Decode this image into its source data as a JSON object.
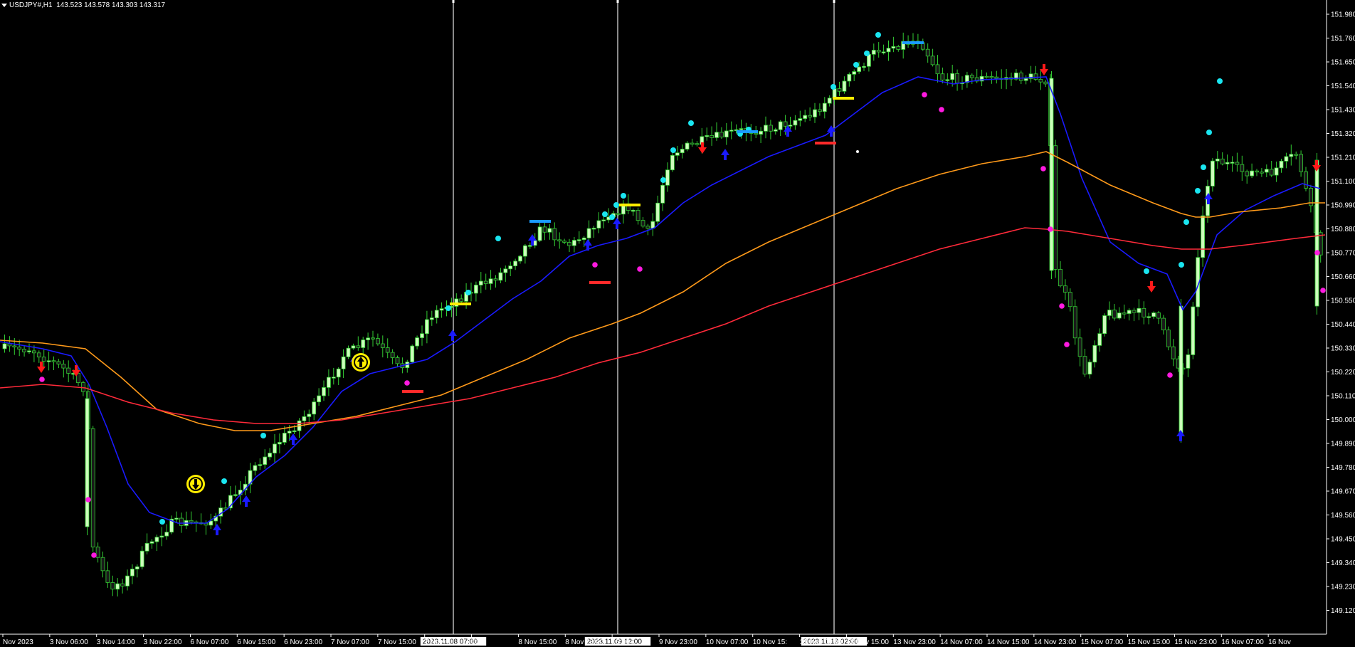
{
  "app": {
    "symbol_label": "USDJPY#,H1",
    "ohlc_text": "143.523 143.578 143.303 143.317"
  },
  "price_axis": {
    "labels": [
      "151.980",
      "151.760",
      "151.650",
      "151.540",
      "151.430",
      "151.320",
      "151.210",
      "151.100",
      "150.990",
      "150.880",
      "150.770",
      "150.660",
      "150.550",
      "150.440",
      "150.330",
      "150.220",
      "150.110",
      "150.000",
      "149.890",
      "149.780",
      "149.670",
      "149.560",
      "149.450",
      "149.340",
      "149.230",
      "149.120"
    ]
  },
  "time_axis": {
    "labels": [
      "Nov 2023",
      "3 Nov 06:00",
      "3 Nov 14:00",
      "3 Nov 22:00",
      "6 Nov 07:00",
      "6 Nov 15:00",
      "6 Nov 23:00",
      "7 Nov 07:00",
      "7 Nov 15:00",
      "7 Nov",
      "00",
      "8 Nov 15:00",
      "8 Nov 23:00",
      "15:00",
      "9 Nov 23:00",
      "10 Nov 07:00",
      "10 Nov 15:",
      "13 Nov 07:00",
      "13 Nov 15:00",
      "13 Nov 23:00",
      "14 Nov 07:00",
      "14 Nov 15:00",
      "14 Nov 23:00",
      "15 Nov 07:00",
      "15 Nov 15:00",
      "15 Nov 23:00",
      "16 Nov 07:00",
      "16 Nov"
    ]
  },
  "vertical_lines": [
    {
      "tag": "2023.11.08 07:00"
    },
    {
      "tag": "2023.11.09 12:00"
    },
    {
      "tag": "2023.11.13 02:00"
    }
  ],
  "colors": {
    "background": "#000000",
    "candle_up": "#ccffbb",
    "candle_down": "#1a1a1a",
    "candle_wick": "#33cc33",
    "ma_fast": "#1a1aff",
    "ma_mid": "#ff9a1a",
    "ma_slow": "#ff2a3a",
    "signal_up": "#1a1aff",
    "signal_down": "#ff1a1a",
    "dot_cyan": "#1ae5f0",
    "dot_magenta": "#ff1ae0",
    "yellow_mark": "#ffee00",
    "blue_bar": "#1a9aff",
    "red_bar": "#ff2a2a"
  },
  "icons": [
    "arrow-up-icon",
    "arrow-down-icon",
    "circle-arrow-up-icon",
    "circle-arrow-down-icon"
  ]
}
